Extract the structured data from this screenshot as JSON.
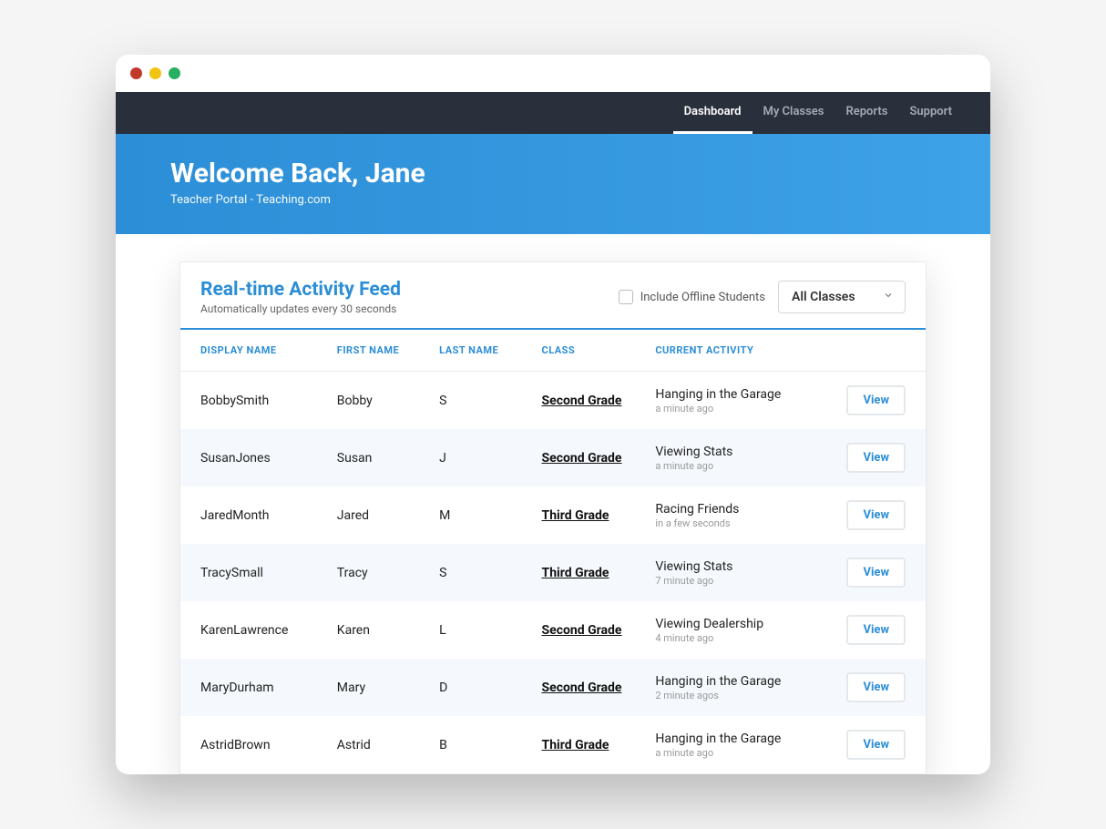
{
  "nav": {
    "items": [
      {
        "label": "Dashboard",
        "active": true
      },
      {
        "label": "My Classes",
        "active": false
      },
      {
        "label": "Reports",
        "active": false
      },
      {
        "label": "Support",
        "active": false
      }
    ]
  },
  "hero": {
    "title": "Welcome Back, Jane",
    "subtitle": "Teacher Portal - Teaching.com"
  },
  "feed": {
    "title": "Real-time Activity Feed",
    "subtitle": "Automatically updates every 30 seconds",
    "include_offline_label": "Include Offline Students",
    "class_filter_selected": "All Classes",
    "columns": {
      "display_name": "DISPLAY NAME",
      "first_name": "FIRST NAME",
      "last_name": "LAST NAME",
      "class": "CLASS",
      "current_activity": "CURRENT ACTIVITY"
    },
    "view_label": "View",
    "rows": [
      {
        "display_name": "BobbySmith",
        "first_name": "Bobby",
        "last_name": "S",
        "class": "Second Grade",
        "activity": "Hanging in the Garage",
        "time": "a minute ago"
      },
      {
        "display_name": "SusanJones",
        "first_name": "Susan",
        "last_name": "J",
        "class": "Second Grade",
        "activity": "Viewing Stats",
        "time": "a minute ago"
      },
      {
        "display_name": "JaredMonth",
        "first_name": "Jared",
        "last_name": "M",
        "class": "Third Grade",
        "activity": "Racing Friends",
        "time": "in a few seconds"
      },
      {
        "display_name": "TracySmall",
        "first_name": "Tracy",
        "last_name": "S",
        "class": "Third Grade",
        "activity": "Viewing Stats",
        "time": "7 minute ago"
      },
      {
        "display_name": "KarenLawrence",
        "first_name": "Karen",
        "last_name": "L",
        "class": "Second Grade",
        "activity": "Viewing Dealership",
        "time": "4 minute ago"
      },
      {
        "display_name": "MaryDurham",
        "first_name": "Mary",
        "last_name": "D",
        "class": "Second Grade",
        "activity": "Hanging in the Garage",
        "time": "2 minute agos"
      },
      {
        "display_name": "AstridBrown",
        "first_name": "Astrid",
        "last_name": "B",
        "class": "Third Grade",
        "activity": "Hanging in the Garage",
        "time": "a minute ago"
      }
    ]
  }
}
